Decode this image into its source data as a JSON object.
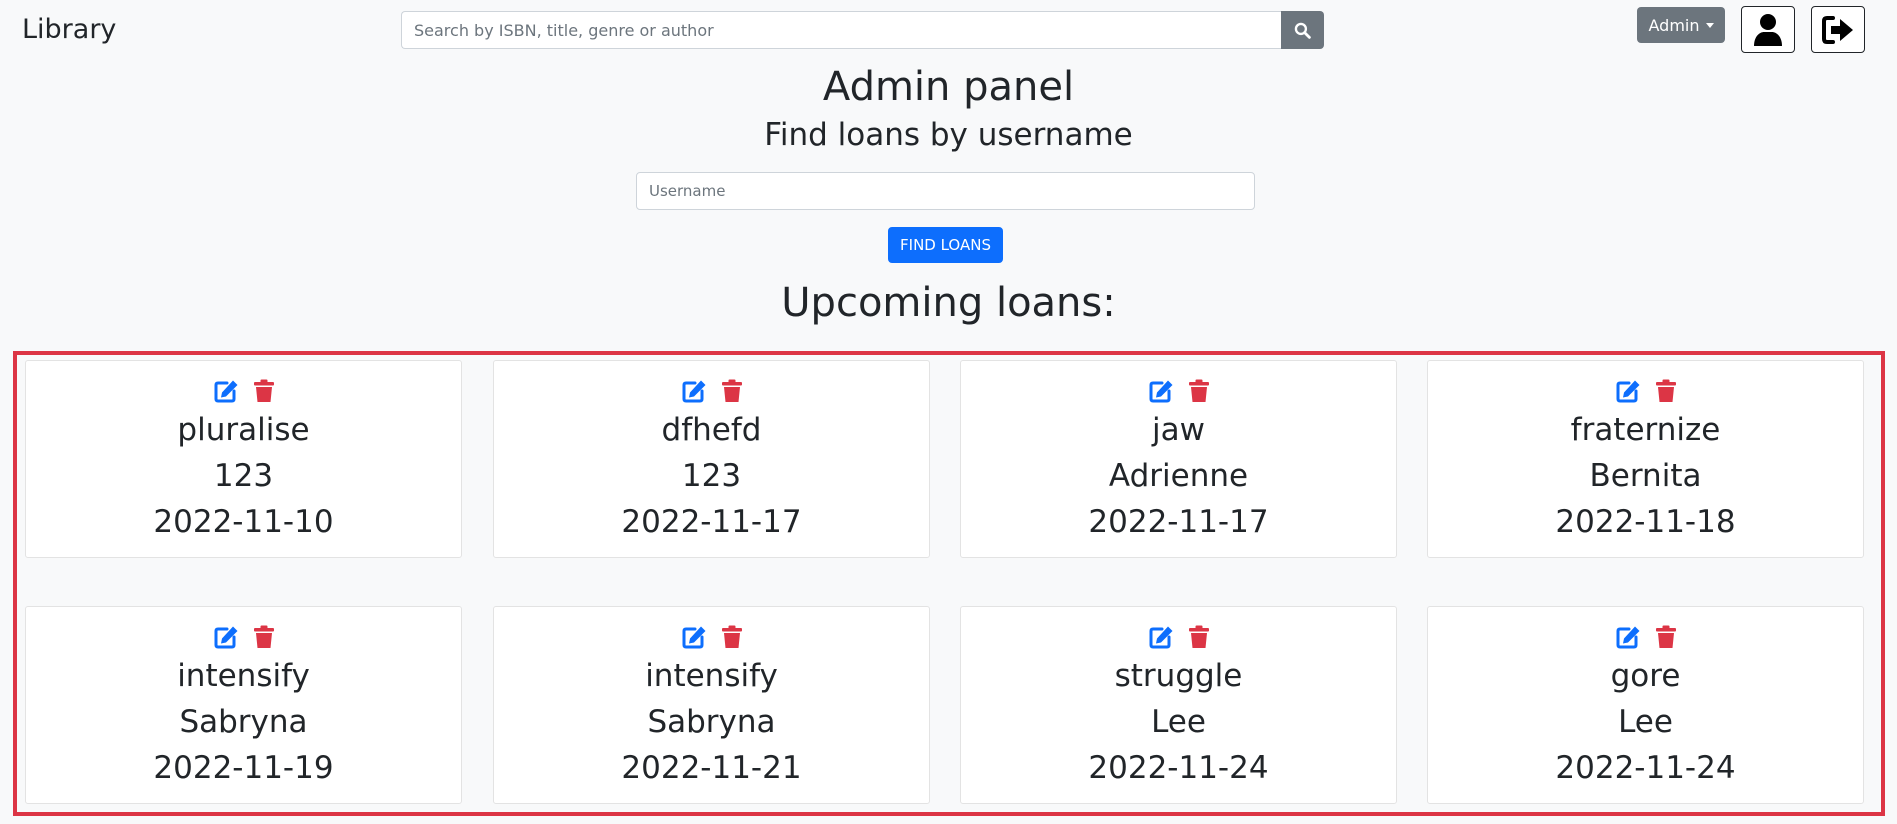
{
  "header": {
    "brand": "Library",
    "search_placeholder": "Search by ISBN, title, genre or author",
    "admin_label": "Admin"
  },
  "panel": {
    "title": "Admin panel",
    "subtitle": "Find loans by username",
    "username_placeholder": "Username",
    "find_button": "FIND LOANS"
  },
  "loans": {
    "title": "Upcoming loans:",
    "items": [
      {
        "book": "pluralise",
        "user": "123",
        "date": "2022-11-10"
      },
      {
        "book": "dfhefd",
        "user": "123",
        "date": "2022-11-17"
      },
      {
        "book": "jaw",
        "user": "Adrienne",
        "date": "2022-11-17"
      },
      {
        "book": "fraternize",
        "user": "Bernita",
        "date": "2022-11-18"
      },
      {
        "book": "intensify",
        "user": "Sabryna",
        "date": "2022-11-19"
      },
      {
        "book": "intensify",
        "user": "Sabryna",
        "date": "2022-11-21"
      },
      {
        "book": "struggle",
        "user": "Lee",
        "date": "2022-11-24"
      },
      {
        "book": "gore",
        "user": "Lee",
        "date": "2022-11-24"
      }
    ]
  },
  "icons": {
    "search": "search-icon",
    "profile": "user-icon",
    "logout": "sign-out-icon",
    "edit": "edit-icon",
    "delete": "trash-icon"
  },
  "colors": {
    "primary": "#0d6efd",
    "danger": "#dc3545",
    "secondary": "#6c757d",
    "background": "#f8f9fa"
  }
}
